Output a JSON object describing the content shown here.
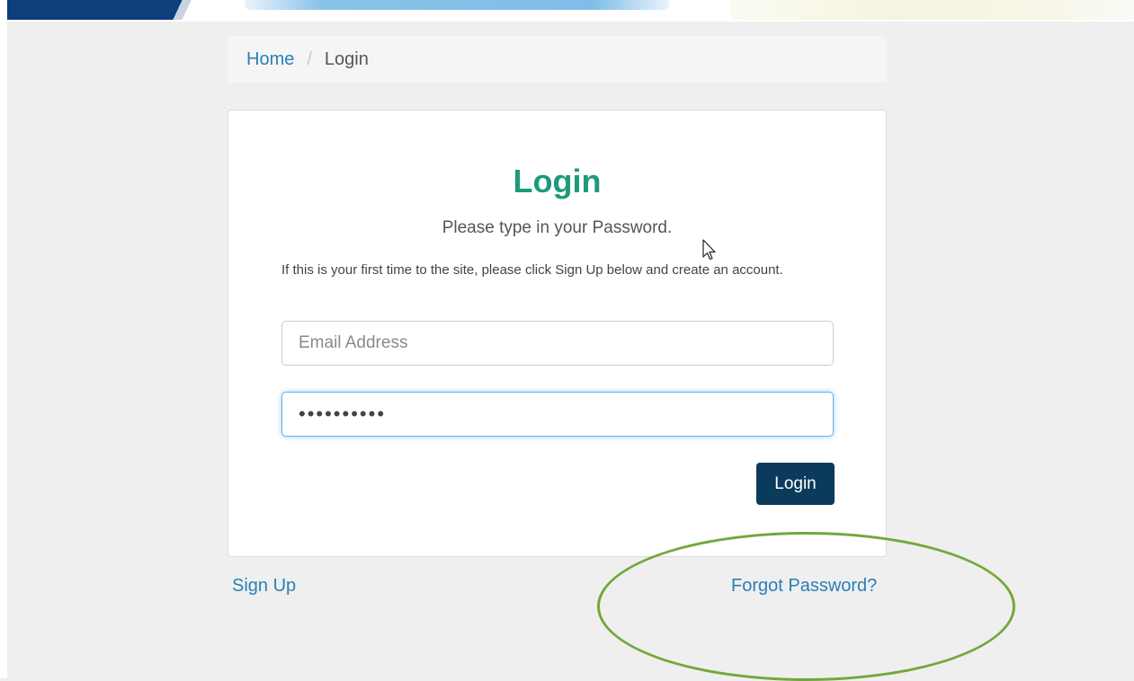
{
  "breadcrumb": {
    "home": "Home",
    "separator": "/",
    "current": "Login"
  },
  "login": {
    "title": "Login",
    "subtitle": "Please type in your Password.",
    "info": "If this is your first time to the site, please click Sign Up below and create an account.",
    "email_placeholder": "Email Address",
    "email_value": "",
    "password_value": "••••••••••",
    "button_label": "Login"
  },
  "links": {
    "sign_up": "Sign Up",
    "forgot_password": "Forgot Password?"
  },
  "colors": {
    "title": "#1e9a7d",
    "button": "#0c3a5c",
    "link": "#2a7fb8",
    "annotation": "#72a83a",
    "focus_border": "#66afe9"
  },
  "icons": {
    "cursor": "mouse-pointer-icon"
  }
}
